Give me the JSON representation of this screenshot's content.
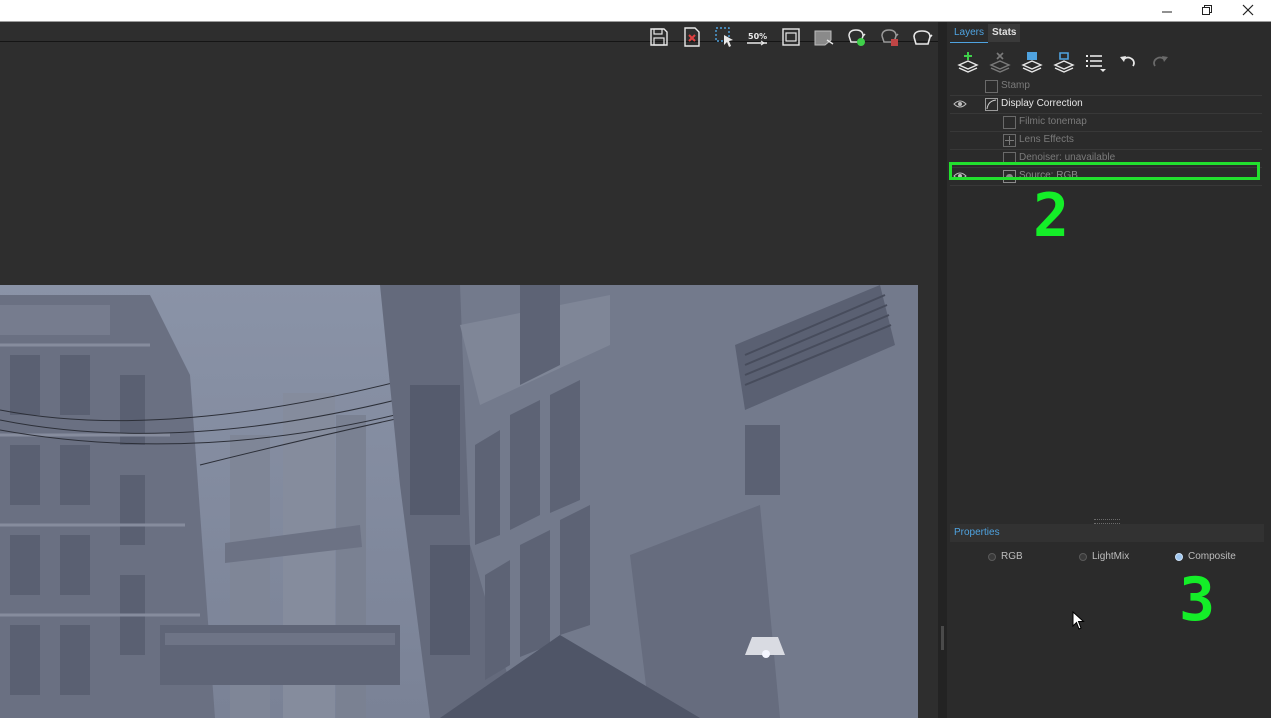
{
  "window": {
    "controls": {
      "minimize_icon": "minimize-icon",
      "restore_icon": "restore-icon",
      "close_icon": "close-icon"
    }
  },
  "viewer": {
    "toolbar": [
      {
        "name": "save-image-icon"
      },
      {
        "name": "clear-image-icon"
      },
      {
        "name": "region-select-icon"
      },
      {
        "name": "zoom-50-icon",
        "label": "50%"
      },
      {
        "name": "frame-icon"
      },
      {
        "name": "render-region-icon"
      },
      {
        "name": "start-render-icon"
      },
      {
        "name": "stop-render-icon"
      },
      {
        "name": "render-last-icon"
      }
    ]
  },
  "panel": {
    "tabs": [
      {
        "label": "Layers",
        "active": true
      },
      {
        "label": "Stats",
        "active": false
      }
    ],
    "layer_toolbar": [
      {
        "name": "add-layer-icon"
      },
      {
        "name": "remove-layer-icon"
      },
      {
        "name": "save-layer-tree-icon"
      },
      {
        "name": "load-layer-tree-icon"
      },
      {
        "name": "layer-list-options-icon"
      },
      {
        "name": "undo-icon"
      },
      {
        "name": "redo-icon"
      }
    ],
    "layers": [
      {
        "label": "Stamp",
        "visible": false,
        "indent": 1,
        "dimmed": true
      },
      {
        "label": "Display Correction",
        "visible": true,
        "indent": 1,
        "dimmed": false
      },
      {
        "label": "Filmic tonemap",
        "visible": false,
        "indent": 2,
        "dimmed": true
      },
      {
        "label": "Lens Effects",
        "visible": false,
        "indent": 2,
        "dimmed": true
      },
      {
        "label": "Denoiser: unavailable",
        "visible": false,
        "indent": 2,
        "dimmed": true
      },
      {
        "label": "Source: RGB",
        "visible": true,
        "indent": 2,
        "dimmed": true,
        "highlighted": true
      }
    ],
    "properties": {
      "title": "Properties",
      "options": [
        {
          "label": "RGB",
          "selected": false
        },
        {
          "label": "LightMix",
          "selected": false
        },
        {
          "label": "Composite",
          "selected": true
        }
      ]
    }
  },
  "annotations": {
    "step_2": "2",
    "step_3": "3",
    "color": "#14ee28"
  }
}
